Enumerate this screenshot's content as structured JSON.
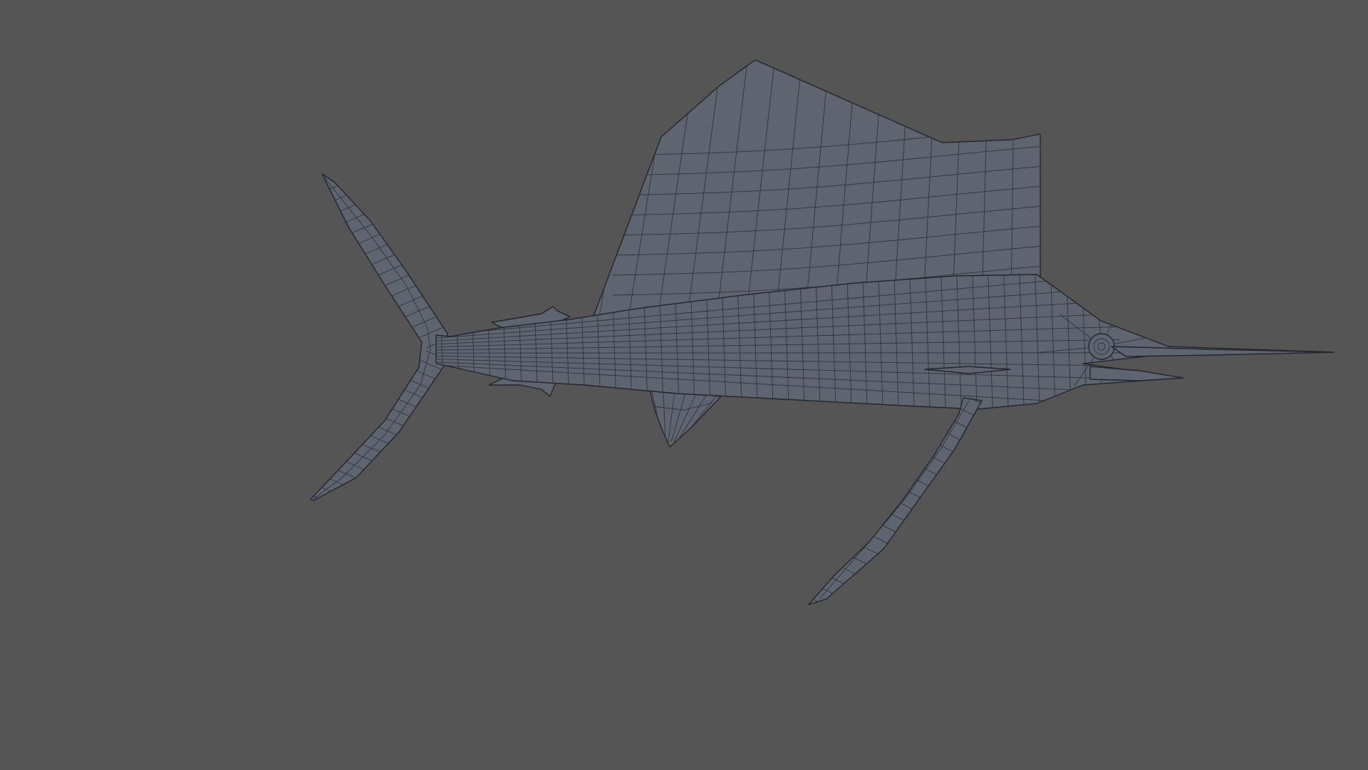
{
  "viewport": {
    "background_color": "#555555",
    "mesh_fill_color": "#5e6570",
    "mesh_wire_color": "#2a2f36",
    "mesh_edge_color": "#22262b"
  },
  "model": {
    "subject": "sailfish",
    "display_mode": "wireframe-on-shaded",
    "icon": "mesh-icon"
  }
}
